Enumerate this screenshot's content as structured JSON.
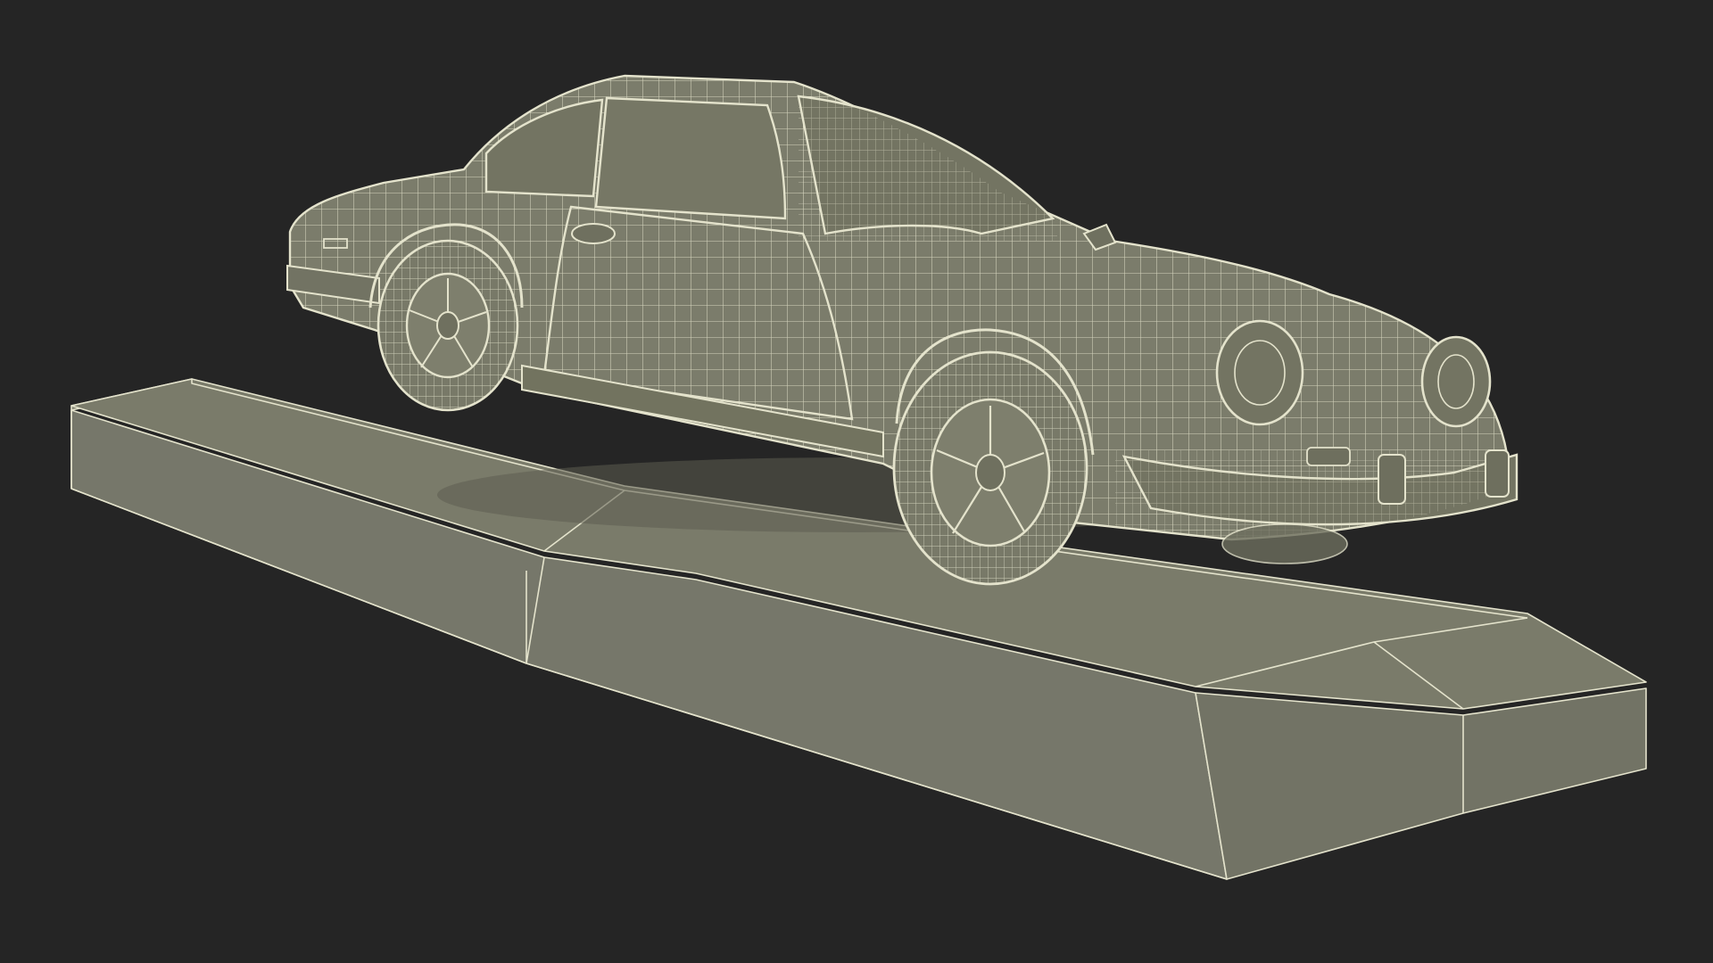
{
  "scene": {
    "subject": "car-wireframe-on-pedestal",
    "render_style": "wireframe",
    "colors": {
      "background": "#252525",
      "surface": "#7a7b6a",
      "surface_dark": "#6a6b5b",
      "surface_light": "#8a8b79",
      "wire": "#e4e3cc",
      "shadow": "#55564a",
      "glass": "#767765"
    }
  }
}
